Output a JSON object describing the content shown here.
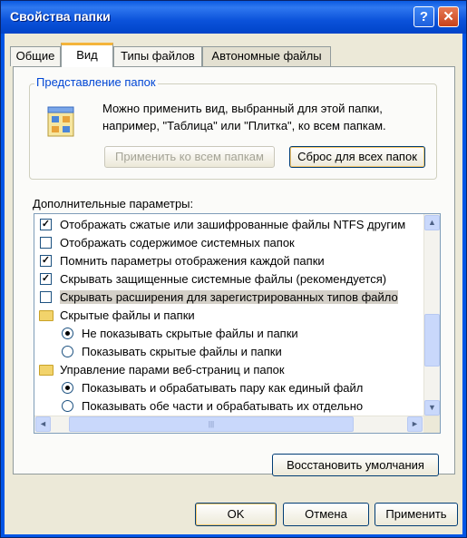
{
  "window": {
    "title": "Свойства папки",
    "help_label": "?",
    "close_label": "✕"
  },
  "tabs": [
    {
      "label": "Общие"
    },
    {
      "label": "Вид"
    },
    {
      "label": "Типы файлов"
    },
    {
      "label": "Автономные файлы"
    }
  ],
  "folder_view": {
    "group_label": "Представление папок",
    "description": "Можно применить вид, выбранный для этой папки, например, \"Таблица\" или \"Плитка\", ко всем папкам.",
    "apply_all_label": "Применить ко всем папкам",
    "reset_all_label": "Сброс для всех папок",
    "icon": "folder-view-icon"
  },
  "advanced": {
    "label": "Дополнительные параметры:",
    "items": [
      {
        "type": "checkbox",
        "checked": true,
        "label": "Отображать сжатые или зашифрованные файлы NTFS другим"
      },
      {
        "type": "checkbox",
        "checked": false,
        "label": "Отображать содержимое системных папок"
      },
      {
        "type": "checkbox",
        "checked": true,
        "label": "Помнить параметры отображения каждой папки"
      },
      {
        "type": "checkbox",
        "checked": true,
        "label": "Скрывать защищенные системные файлы (рекомендуется)"
      },
      {
        "type": "checkbox",
        "checked": false,
        "label": "Скрывать расширения для зарегистрированных типов файло",
        "selected": true
      },
      {
        "type": "folder",
        "label": "Скрытые файлы и папки"
      },
      {
        "type": "radio",
        "checked": true,
        "label": "Не показывать скрытые файлы и папки"
      },
      {
        "type": "radio",
        "checked": false,
        "label": "Показывать скрытые файлы и папки"
      },
      {
        "type": "folder",
        "label": "Управление парами веб-страниц и папок"
      },
      {
        "type": "radio",
        "checked": true,
        "label": "Показывать и обрабатывать пару как единый файл"
      },
      {
        "type": "radio",
        "checked": false,
        "label": "Показывать обе части и обрабатывать их отдельно"
      }
    ]
  },
  "restore_defaults_label": "Восстановить умолчания",
  "footer": {
    "ok_label": "OK",
    "cancel_label": "Отмена",
    "apply_label": "Применить"
  },
  "scrollbar": {
    "up": "▲",
    "down": "▼",
    "left": "◄",
    "right": "►",
    "grip": "|||"
  }
}
